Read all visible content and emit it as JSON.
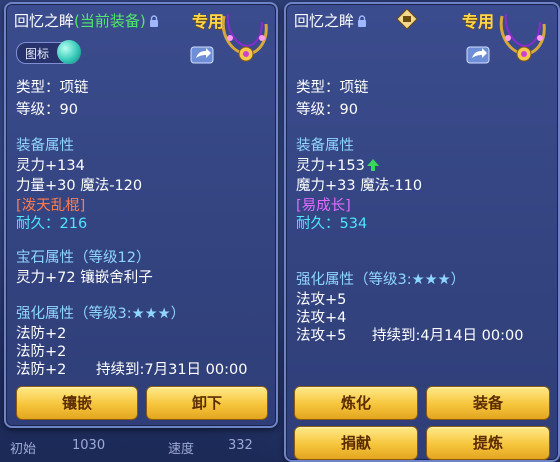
{
  "left": {
    "name": "回忆之眸",
    "equipped_tag": "(当前装备)",
    "special": "专用",
    "toggle_label": "图标",
    "type_line": "类型：项链",
    "level_line": "等级：90",
    "equip_attr_header": "装备属性",
    "attr_lines": [
      "灵力+134",
      "力量+30 魔法-120"
    ],
    "special_skill": "[泼天乱棍]",
    "durability": "耐久：216",
    "gem_header": "宝石属性（等级12）",
    "gem_line": "灵力+72 镶嵌舍利子",
    "enhance_header": "强化属性（等级3:★★★）",
    "enhance_lines": [
      "法防+2",
      "法防+2",
      "法防+2"
    ],
    "duration": "持续到:7月31日 00:00",
    "buttons": [
      "镶嵌",
      "卸下"
    ]
  },
  "right": {
    "name": "回忆之眸",
    "special": "专用",
    "type_line": "类型：项链",
    "level_line": "等级：90",
    "equip_attr_header": "装备属性",
    "attr_line_1": "灵力+153",
    "attr_line_2": "魔力+33 魔法-110",
    "special_skill": "[易成长]",
    "durability": "耐久：534",
    "enhance_header": "强化属性（等级3:★★★）",
    "enhance_lines": [
      "法攻+5",
      "法攻+4",
      "法攻+5"
    ],
    "duration": "持续到:4月14日 00:00",
    "buttons": [
      "炼化",
      "装备",
      "捐献",
      "提炼"
    ]
  },
  "background": {
    "bottom_left_label": "初始",
    "bottom_left_value": "1030",
    "bottom_mid_label": "速度",
    "bottom_mid_value": "332"
  },
  "colors": {
    "equipped": "#4fe86a",
    "section": "#8fd6ff",
    "special_skill_left": "#ff7b4f",
    "special_skill_right": "#e06aff",
    "durability": "#4fe5ff",
    "title_special": "#ffd84a"
  }
}
